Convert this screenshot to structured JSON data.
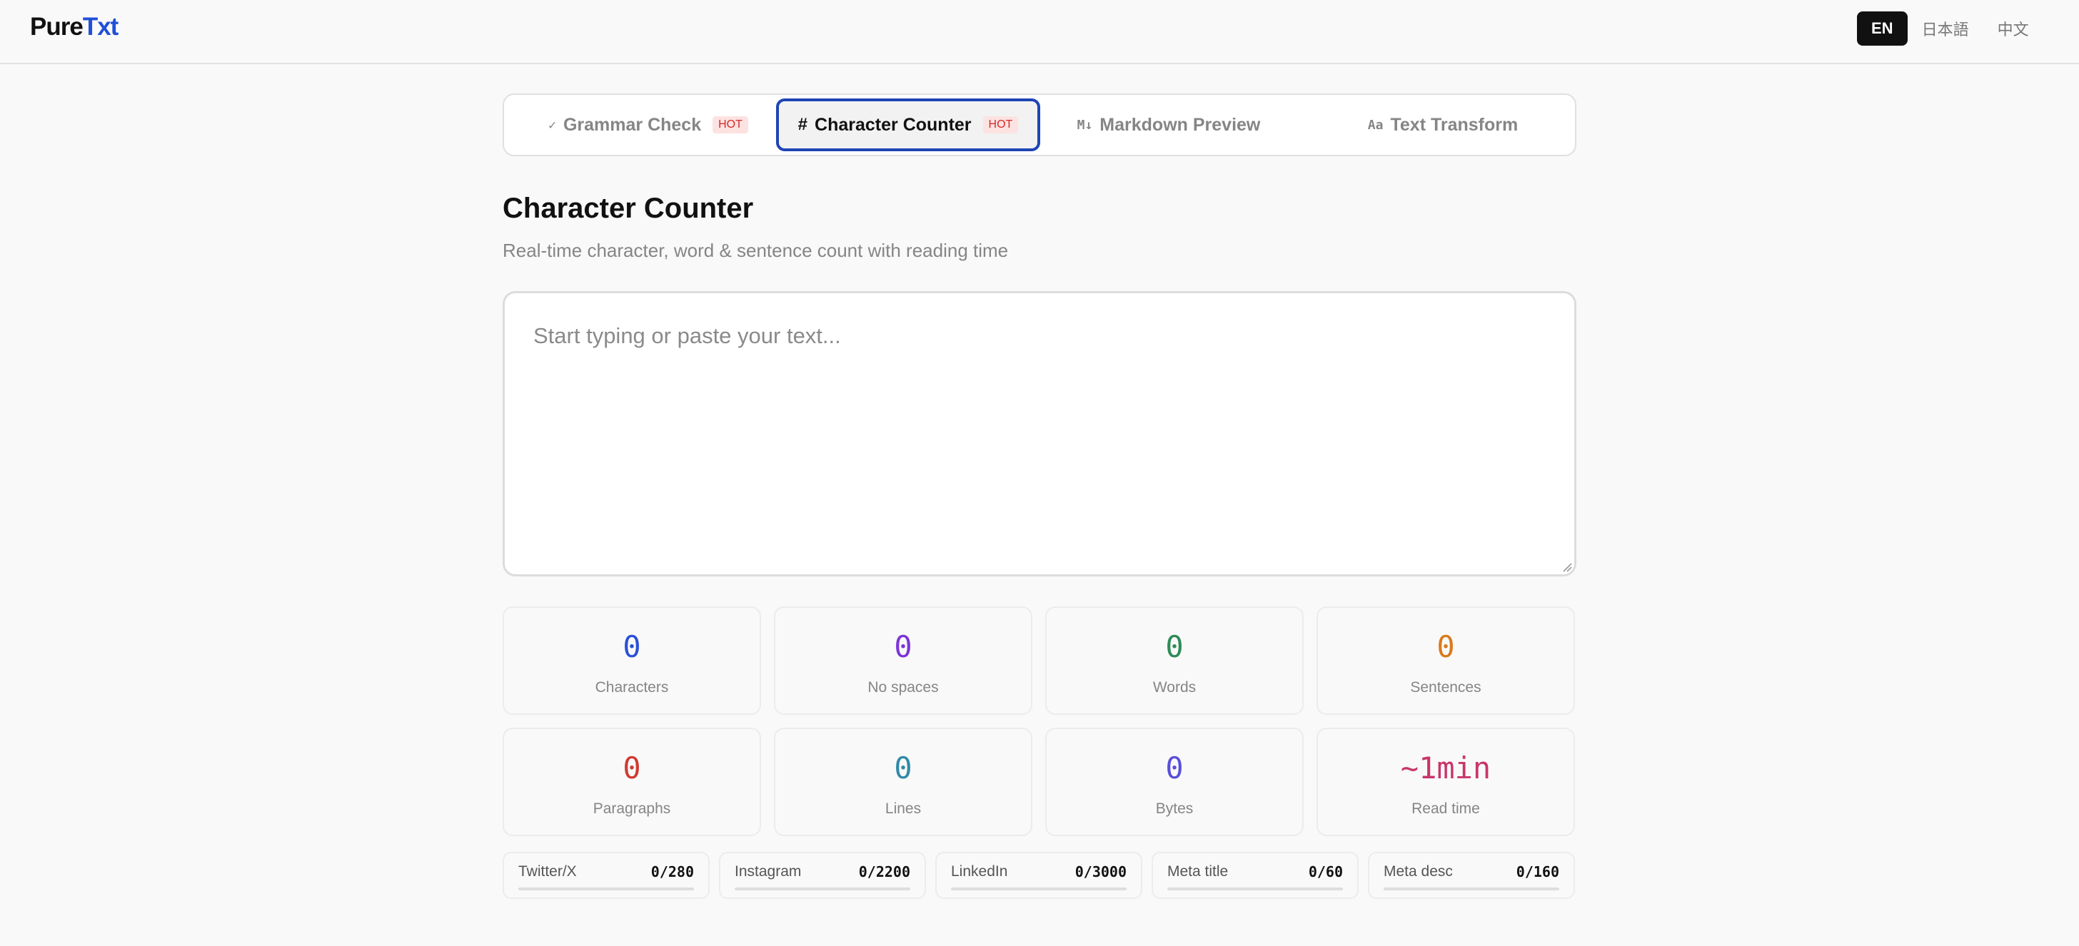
{
  "brand": {
    "part1": "Pure",
    "part2": "Txt",
    "color1": "#111111",
    "color2": "#2050d8"
  },
  "languages": [
    {
      "label": "EN",
      "active": true
    },
    {
      "label": "日本語",
      "active": false
    },
    {
      "label": "中文",
      "active": false
    }
  ],
  "tabs": [
    {
      "icon": "✓",
      "label": "Grammar Check",
      "badge": "HOT",
      "active": false
    },
    {
      "icon": "#",
      "label": "Character Counter",
      "badge": "HOT",
      "active": true
    },
    {
      "icon": "M↓",
      "label": "Markdown Preview",
      "badge": "",
      "active": false
    },
    {
      "icon": "Aa",
      "label": "Text Transform",
      "badge": "",
      "active": false
    }
  ],
  "page": {
    "title": "Character Counter",
    "subtitle": "Real-time character, word & sentence count with reading time"
  },
  "editor": {
    "placeholder": "Start typing or paste your text...",
    "value": ""
  },
  "stats": [
    {
      "value": "0",
      "label": "Characters",
      "color": "#2b50d6"
    },
    {
      "value": "0",
      "label": "No spaces",
      "color": "#7b33d9"
    },
    {
      "value": "0",
      "label": "Words",
      "color": "#2e8b57"
    },
    {
      "value": "0",
      "label": "Sentences",
      "color": "#d97a1e"
    },
    {
      "value": "0",
      "label": "Paragraphs",
      "color": "#cf3a32"
    },
    {
      "value": "0",
      "label": "Lines",
      "color": "#2f8aa8"
    },
    {
      "value": "0",
      "label": "Bytes",
      "color": "#5a4fd8"
    },
    {
      "value": "~1min",
      "label": "Read time",
      "color": "#c8366b"
    }
  ],
  "limits": [
    {
      "name": "Twitter/X",
      "value": "0/280",
      "fraction": 0
    },
    {
      "name": "Instagram",
      "value": "0/2200",
      "fraction": 0
    },
    {
      "name": "LinkedIn",
      "value": "0/3000",
      "fraction": 0
    },
    {
      "name": "Meta title",
      "value": "0/60",
      "fraction": 0
    },
    {
      "name": "Meta desc",
      "value": "0/160",
      "fraction": 0
    }
  ]
}
